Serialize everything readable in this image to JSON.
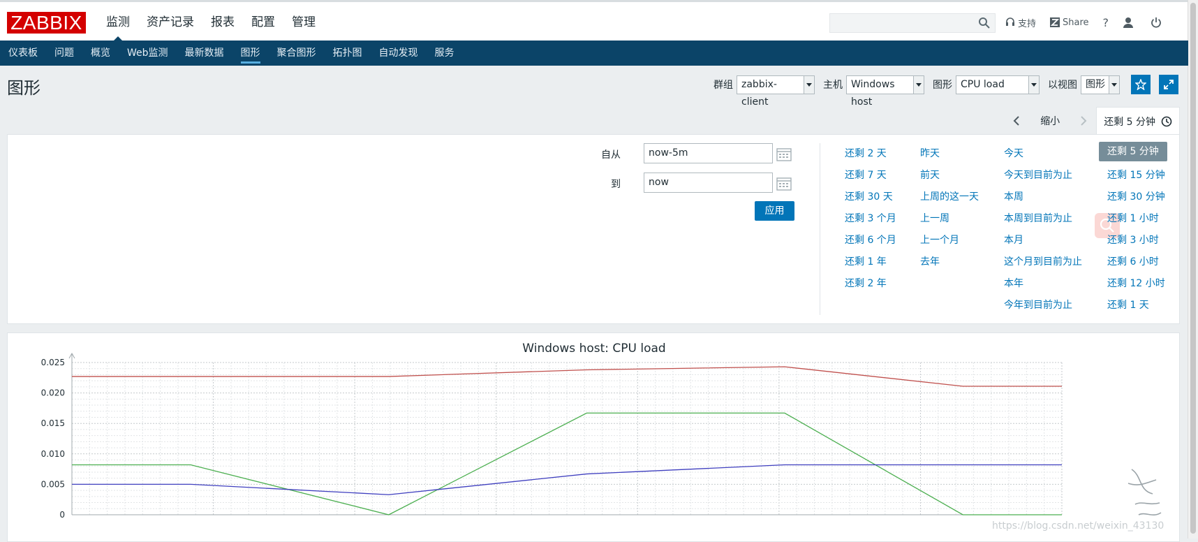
{
  "logo": "ZABBIX",
  "main_nav": [
    "监测",
    "资产记录",
    "报表",
    "配置",
    "管理"
  ],
  "top_links": {
    "support": "支持",
    "share": "Share",
    "help": "?"
  },
  "sub_nav": [
    "仪表板",
    "问题",
    "概览",
    "Web监测",
    "最新数据",
    "图形",
    "聚合图形",
    "拓扑图",
    "自动发现",
    "服务"
  ],
  "page_title": "图形",
  "filters": {
    "group_label": "群组",
    "group_value": "zabbix-client",
    "host_label": "主机",
    "host_value": "Windows host",
    "graph_label": "图形",
    "graph_value": "CPU load",
    "view_label": "以视图",
    "view_value": "图形"
  },
  "time_tabs": {
    "zoom_out": "缩小",
    "selected": "还剩 5 分钟"
  },
  "time_form": {
    "from_label": "自从",
    "from_value": "now-5m",
    "to_label": "到",
    "to_value": "now",
    "apply": "应用"
  },
  "quick_ranges": {
    "col1": [
      "还剩 2 天",
      "还剩 7 天",
      "还剩 30 天",
      "还剩 3 个月",
      "还剩 6 个月",
      "还剩 1 年",
      "还剩 2 年"
    ],
    "col2": [
      "昨天",
      "前天",
      "上周的这一天",
      "上一周",
      "上一个月",
      "去年"
    ],
    "col3": [
      "今天",
      "今天到目前为止",
      "本周",
      "本周到目前为止",
      "本月",
      "这个月到目前为止",
      "本年",
      "今年到目前为止"
    ],
    "col4": [
      "还剩 5 分钟",
      "还剩 15 分钟",
      "还剩 30 分钟",
      "还剩 1 小时",
      "还剩 3 小时",
      "还剩 6 小时",
      "还剩 12 小时",
      "还剩 1 天"
    ]
  },
  "watermark": "https://blog.csdn.net/weixin_43130",
  "chart_data": {
    "type": "line",
    "title": "Windows host: CPU load",
    "ylim": [
      0,
      0.025
    ],
    "y_ticks": [
      "0.025",
      "0.020",
      "0.015",
      "0.010",
      "0.005",
      "0"
    ],
    "x": [
      0,
      0.12,
      0.32,
      0.52,
      0.72,
      0.9,
      1.0
    ],
    "series": [
      {
        "color": "#c0504d",
        "values": [
          0.0227,
          0.0227,
          0.0227,
          0.0238,
          0.0243,
          0.0211,
          0.0211
        ]
      },
      {
        "color": "#4caf50",
        "values": [
          0.0082,
          0.0082,
          0.0,
          0.0167,
          0.0167,
          0.0,
          0.0
        ]
      },
      {
        "color": "#3f3fbf",
        "values": [
          0.005,
          0.005,
          0.0033,
          0.0067,
          0.0082,
          0.0082,
          0.0082
        ]
      }
    ],
    "grid": true
  }
}
